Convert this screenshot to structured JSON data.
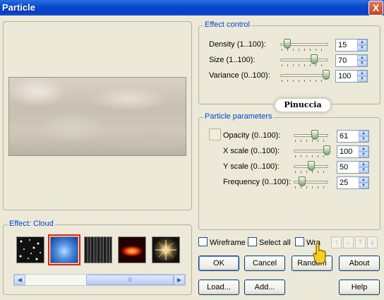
{
  "window": {
    "title": "Particle",
    "close_label": "X"
  },
  "effect_control": {
    "legend": "Effect control",
    "rows": [
      {
        "label": "Density (1..100):",
        "value": "15",
        "level": 0.15
      },
      {
        "label": "Size (1..100):",
        "value": "70",
        "level": 0.7
      },
      {
        "label": "Variance (0..100):",
        "value": "100",
        "level": 1.0
      }
    ]
  },
  "logo": {
    "text": "Pinuccia"
  },
  "particle_parameters": {
    "legend": "Particle parameters",
    "swatch_color": "#f4ebda",
    "rows": [
      {
        "label": "Opacity (0..100):",
        "value": "61",
        "level": 0.61
      },
      {
        "label": "X scale (0..100):",
        "value": "100",
        "level": 1.0
      },
      {
        "label": "Y scale (0..100):",
        "value": "50",
        "level": 0.5
      },
      {
        "label": "Frequency (0..100):",
        "value": "25",
        "level": 0.25
      }
    ]
  },
  "effect": {
    "legend": "Effect: Cloud",
    "thumbs": [
      "stars",
      "cloud",
      "smoke",
      "fire",
      "flare"
    ],
    "selected": "cloud"
  },
  "options": {
    "wireframe": "Wireframe",
    "select_all": "Select all",
    "wrap": "Wra"
  },
  "buttons": {
    "ok": "OK",
    "cancel": "Cancel",
    "random": "Random",
    "about": "About",
    "load": "Load...",
    "add": "Add...",
    "help": "Help"
  },
  "colors": {
    "title_bar": "#0a4ad0",
    "legend": "#0046d5",
    "selection": "#e0201a"
  }
}
